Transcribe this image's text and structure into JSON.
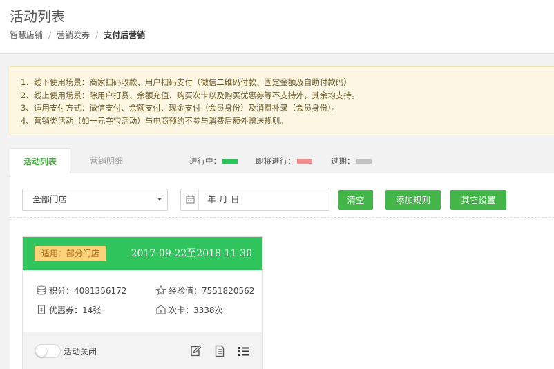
{
  "page": {
    "title": "活动列表",
    "breadcrumb": [
      "智慧店铺",
      "营销发券",
      "支付后营销"
    ]
  },
  "notice": {
    "lines": [
      "1、线下使用场景：商家扫码收款、用户扫码支付（微信二维码付款、固定金额及自助付款码）",
      "2、线上使用场景：除用户打赏、余额充值、购买次卡以及购买优惠券等不支持外，其余均支持。",
      "3、适用支付方式：微信支付、余额支付、现金支付（会员身份）及消费补录（会员身份）。",
      "4、营销类活动（如一元夺宝活动）与电商预约不参与消费后额外赠送规则。"
    ]
  },
  "tabs": [
    {
      "label": "活动列表",
      "active": true
    },
    {
      "label": "营销明细",
      "active": false
    }
  ],
  "legend": [
    {
      "label": "进行中：",
      "color": "#2fc45a"
    },
    {
      "label": "即将进行：",
      "color": "#f58e8e"
    },
    {
      "label": "过期：",
      "color": "#c2c2c2"
    }
  ],
  "filters": {
    "store_select": "全部门店",
    "date_placeholder": "年-月-日"
  },
  "buttons": {
    "clear": "清空",
    "add_rule": "添加规则",
    "other_settings": "其它设置"
  },
  "card": {
    "scope": "适用：部分门店",
    "date_range": "2017-09-22至2018-11-30",
    "points_label": "积分：",
    "points_value": "4081356172",
    "exp_label": "经验值：",
    "exp_value": "7551820562",
    "coupon_label": "优惠券：",
    "coupon_value": "14张",
    "times_label": "次卡：",
    "times_value": "3338次",
    "toggle_label": "活动关闭",
    "enabled": false
  },
  "colors": {
    "brand_green": "#44b549",
    "card_header": "#31c55d",
    "scope_badge": "#fcd27a"
  }
}
